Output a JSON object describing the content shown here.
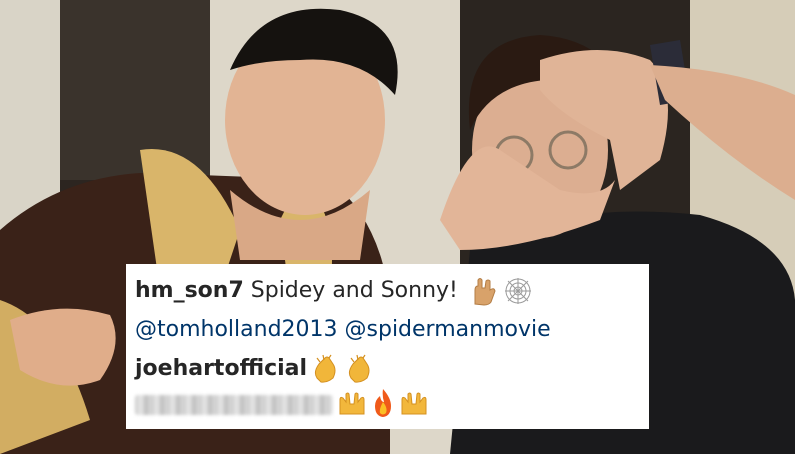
{
  "post_photo": {
    "description_icon": "photo-of-two-men-posing"
  },
  "comments": [
    {
      "username": "hm_son7",
      "text": " Spidey and Sonny! ",
      "emojis": [
        "rock-on-hand-icon",
        "spider-web-icon"
      ],
      "mentions": "@tomholland2013 @spidermanmovie"
    },
    {
      "username": "joehartofficial",
      "emojis": [
        "clapping-hands-icon",
        "clapping-hands-icon"
      ]
    },
    {
      "username_blurred": true,
      "emojis": [
        "raising-hands-icon",
        "fire-icon",
        "raising-hands-icon"
      ]
    }
  ],
  "colors": {
    "text": "#262626",
    "mention": "#003569",
    "overlay_bg": "#ffffff"
  }
}
